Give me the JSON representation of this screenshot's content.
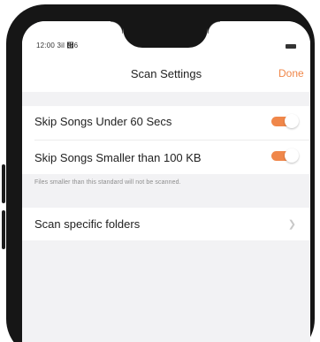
{
  "status_bar": {
    "time": "12:00 3il ὏6",
    "battery_icon": "battery-icon"
  },
  "nav": {
    "title": "Scan Settings",
    "done_label": "Done",
    "accent_color": "#f0874a"
  },
  "settings": {
    "skip_short": {
      "label": "Skip Songs Under 60 Secs",
      "enabled": true
    },
    "skip_small": {
      "label": "Skip Songs Smaller than 100 KB",
      "enabled": true
    },
    "note": "Files smaller than this standard will not be scanned.",
    "scan_folders": {
      "label": "Scan specific folders",
      "chevron_icon": "chevron-right-icon"
    }
  }
}
